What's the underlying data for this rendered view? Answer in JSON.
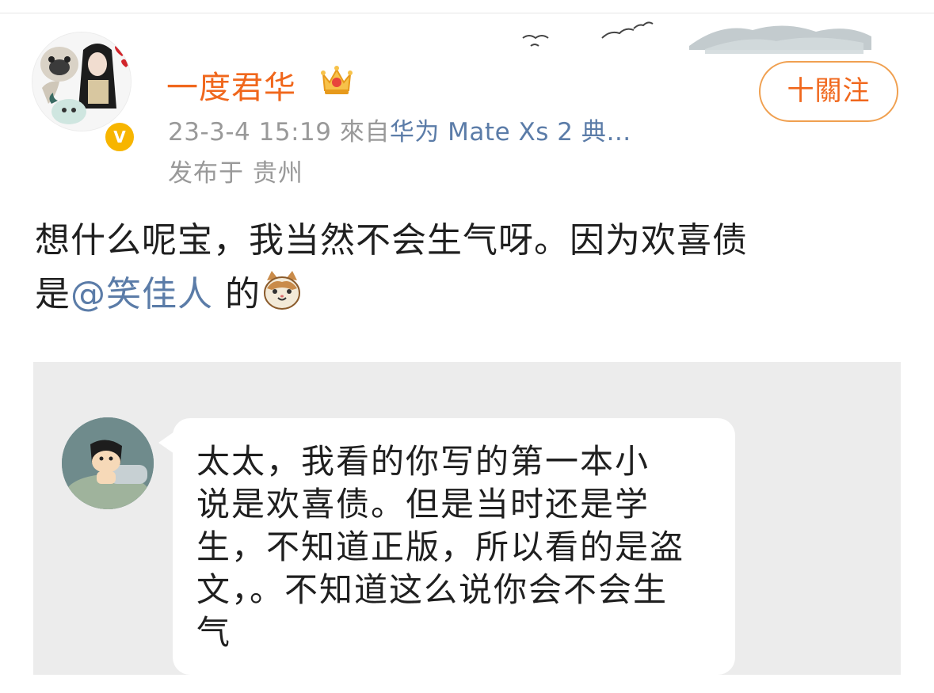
{
  "user": {
    "name": "一度君华",
    "verified_badge": "V"
  },
  "meta": {
    "timestamp": "23-3-4 15:19",
    "source_prefix": "來自",
    "source": "华为 Mate Xs 2 典…",
    "location": "发布于 贵州"
  },
  "follow_button": {
    "label": "十關注"
  },
  "post": {
    "text_line1": "想什么呢宝，我当然不会生气呀。因为欢喜债",
    "text_prefix2": "是",
    "mention": "@笑佳人",
    "text_suffix2": " 的"
  },
  "quoted_message": {
    "text": "太太，我看的你写的第一本小\n说是欢喜债。但是当时还是学\n生，不知道正版，所以看的是盗\n文，。不知道这么说你会不会生\n气"
  },
  "colors": {
    "accent": "#f0671c",
    "link": "#5b7ca8",
    "meta": "#999999",
    "quote_bg": "#ececec"
  }
}
